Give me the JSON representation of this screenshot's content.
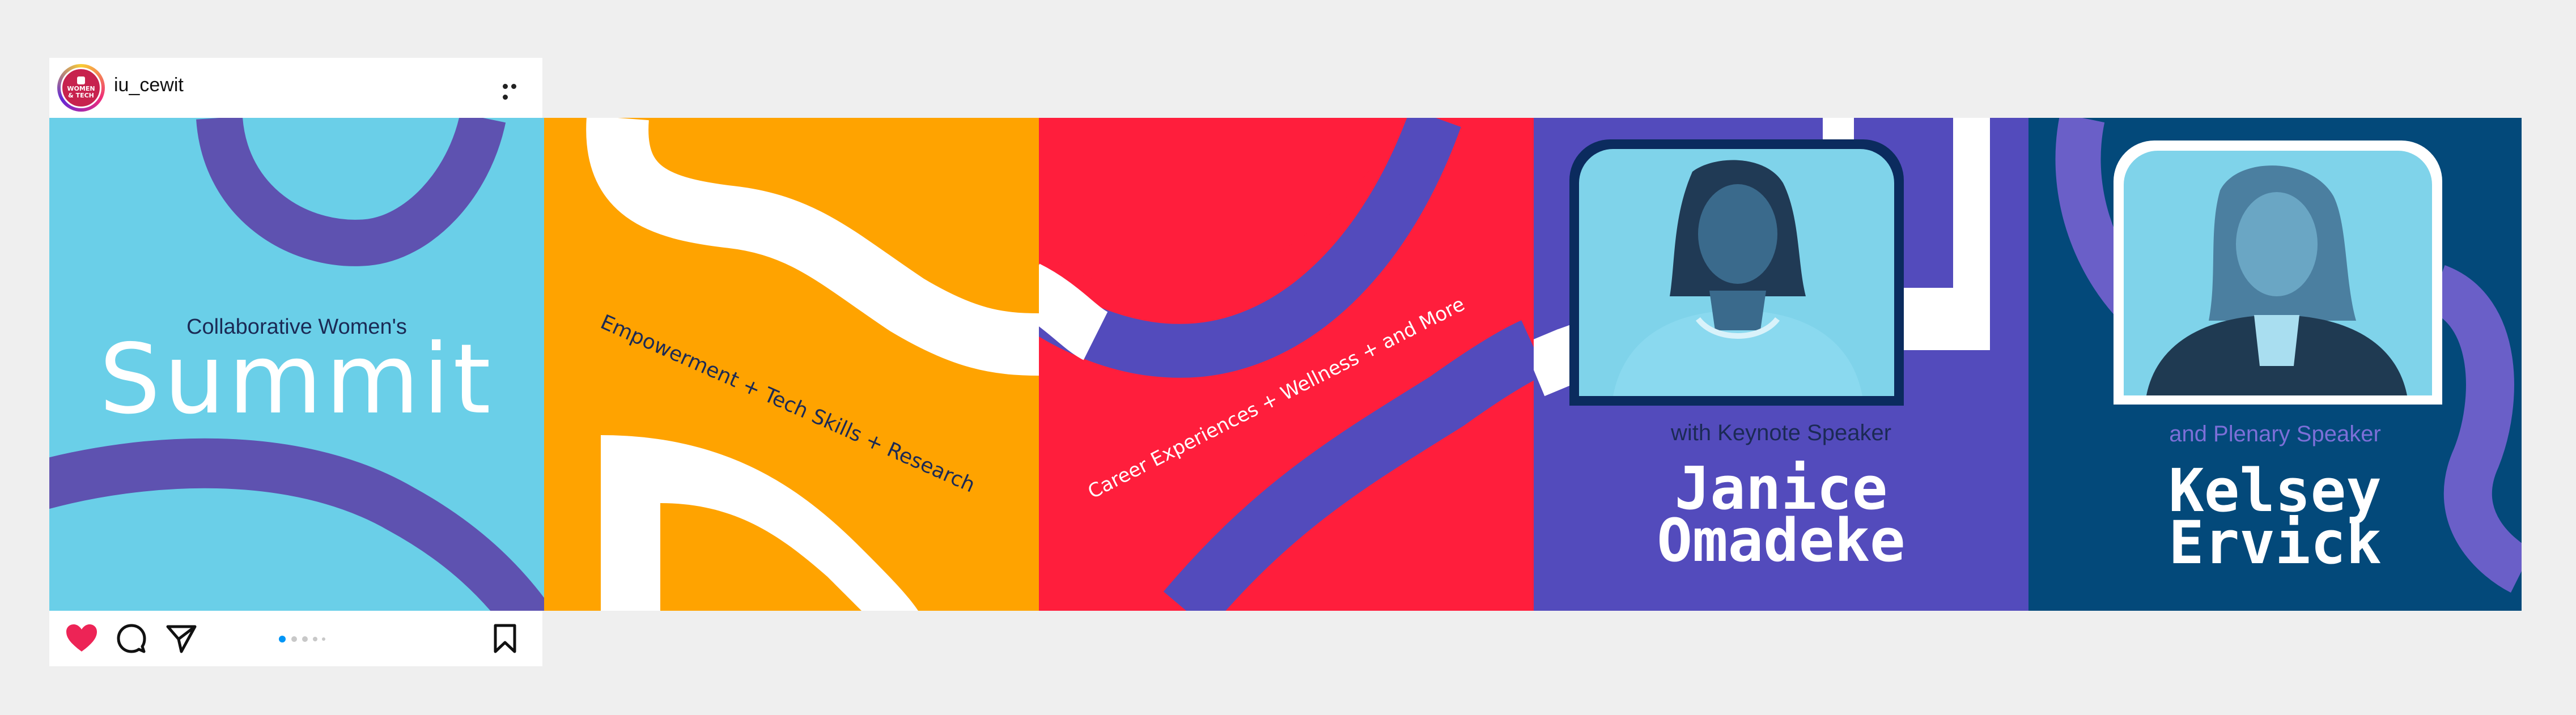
{
  "post": {
    "username": "iu_cewit",
    "avatar_text": [
      "WOMEN",
      "& TECH"
    ]
  },
  "slides": {
    "s1": {
      "subtitle": "Collaborative Women's",
      "title": "Summit"
    },
    "s2": {
      "text": "Empowerment + Tech Skills + Research"
    },
    "s3": {
      "text": "Career Experiences + Wellness + and More"
    },
    "s4": {
      "label": "with Keynote Speaker",
      "name_line1": "Janice",
      "name_line2": "Omadeke"
    },
    "s5": {
      "label": "and Plenary Speaker",
      "name_line1": "Kelsey",
      "name_line2": "Ervick"
    }
  },
  "icons": [
    "more-options-icon",
    "heart-icon",
    "comment-icon",
    "share-icon",
    "bookmark-icon"
  ],
  "carousel": {
    "count": 5,
    "active": 1
  },
  "colors": {
    "background": "#efefef",
    "sky": "#6acfe8",
    "purple": "#5e52b0",
    "orange": "#ffa300",
    "red": "#ff1e3c",
    "violet": "#534bbc",
    "navy": "#03497a",
    "dark_navy": "#1b2a55",
    "heart": "#ed2456",
    "dot_active": "#0095f6"
  }
}
